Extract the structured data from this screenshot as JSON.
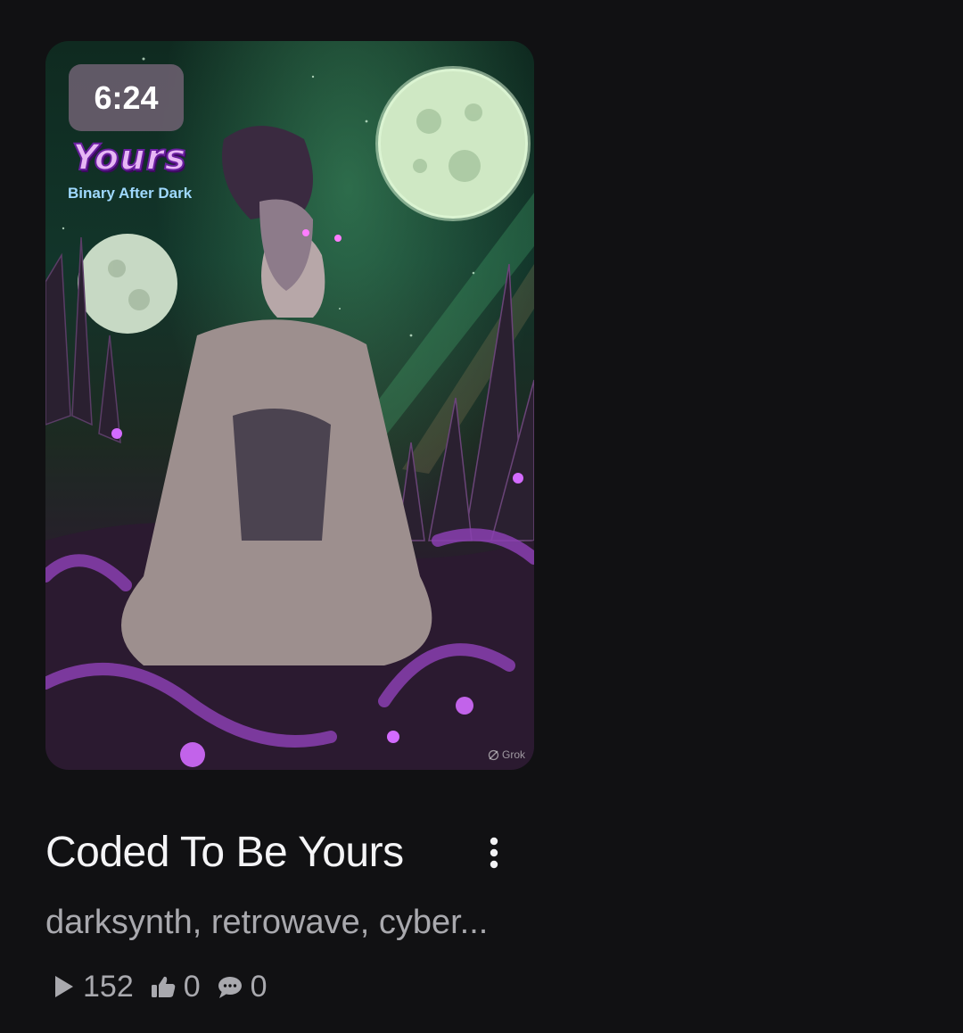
{
  "card": {
    "duration": "6:24",
    "cover_title": "Yours",
    "cover_artist": "Binary After Dark",
    "watermark": "Grok",
    "title": "Coded To Be Yours",
    "tags": "darksynth, retrowave, cyber...",
    "stats": {
      "plays": "152",
      "likes": "0",
      "comments": "0"
    }
  },
  "icons": {
    "more": "more-vertical-icon",
    "plays": "play-icon",
    "likes": "thumbs-up-icon",
    "comments": "comment-icon"
  },
  "colors": {
    "background": "#111113",
    "glow_purple": "#c14bff",
    "moon_green": "#cfe8c4"
  }
}
